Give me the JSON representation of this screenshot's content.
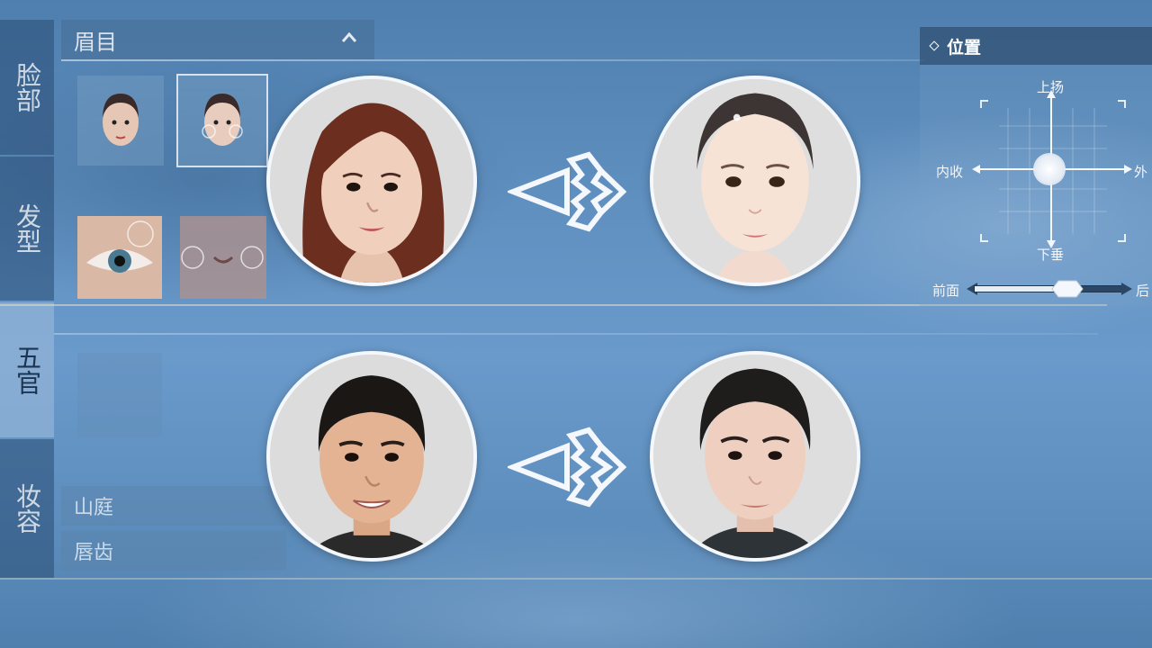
{
  "tabs": [
    {
      "label": "脸部",
      "active": false
    },
    {
      "label": "发型",
      "active": false
    },
    {
      "label": "五官",
      "active": true
    },
    {
      "label": "妆容",
      "active": false
    }
  ],
  "panel": {
    "header": "眉目",
    "list_items": [
      "山庭",
      "唇齿"
    ]
  },
  "position_panel": {
    "title": "位置",
    "up": "上扬",
    "down": "下垂",
    "left": "内收",
    "right": "外",
    "slider_left": "前面",
    "slider_right": "后",
    "slider_value": 0.62
  },
  "comparisons": [
    {
      "from": "female-photo",
      "to": "female-game-avatar"
    },
    {
      "from": "male-photo",
      "to": "male-game-avatar"
    }
  ],
  "colors": {
    "accent": "#f4f7fb",
    "panel_dark": "#2c4766",
    "background": "#6a9acb"
  }
}
